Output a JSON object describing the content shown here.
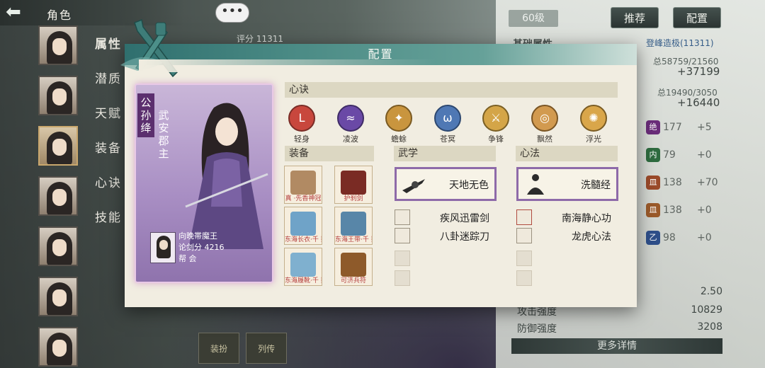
{
  "topbar": {
    "title": "角色"
  },
  "chat": {
    "label": "•••"
  },
  "level": "60级",
  "buttons": {
    "recommend": "推荐",
    "config": "配置"
  },
  "score_bg": "评分 11311",
  "basic_attr": "基础属性",
  "ascend": "登峰造极(11311)",
  "sidebar": {
    "menu": [
      "属性",
      "潜质",
      "天赋",
      "装备",
      "心诀",
      "技能"
    ]
  },
  "right_stats": {
    "total1": "总58759/21560",
    "big1": "+37199",
    "total2": "总19490/3050",
    "big2": "+16440",
    "gems": [
      {
        "glyph": "绝",
        "color": "#6a2d7a",
        "num": "177",
        "plus": "+5"
      },
      {
        "glyph": "内",
        "color": "#2e6b3f",
        "num": "79",
        "plus": "+0"
      },
      {
        "glyph": "皿",
        "color": "#9b4a2a",
        "num": "138",
        "plus": "+70"
      },
      {
        "glyph": "皿",
        "color": "#9b5a2a",
        "num": "138",
        "plus": "+0"
      },
      {
        "glyph": "乙",
        "color": "#2e4f8a",
        "num": "98",
        "plus": "+0"
      }
    ],
    "bottom": [
      {
        "label": "",
        "value": "2.50"
      },
      {
        "label": "攻击强度",
        "value": "10829"
      },
      {
        "label": "防御强度",
        "value": "3208"
      }
    ],
    "more": "更多详情"
  },
  "bottom_icons": [
    "装扮",
    "列传"
  ],
  "modal": {
    "title": "配置",
    "character": {
      "name": "公孙绛",
      "title": "武安郡主",
      "owner": "向晚帯魔王",
      "score": "论剑分 4216",
      "guild": "帮  会"
    },
    "xinjue_header": "心诀",
    "xinjue": [
      {
        "label": "轻身",
        "color": "#c8473d",
        "glyph": "L",
        "ring": "#7a2d27"
      },
      {
        "label": "凌波",
        "color": "#6a49a6",
        "glyph": "≈",
        "ring": "#3f2c66"
      },
      {
        "label": "蟾蜍",
        "color": "#c9953e",
        "glyph": "✦",
        "ring": "#7a5a22"
      },
      {
        "label": "苍冥",
        "color": "#4f78b4",
        "glyph": "ω",
        "ring": "#2d4870"
      },
      {
        "label": "争锋",
        "color": "#d4a548",
        "glyph": "⚔",
        "ring": "#7a5f24"
      },
      {
        "label": "飘然",
        "color": "#d29a4f",
        "glyph": "◎",
        "ring": "#7a5524"
      },
      {
        "label": "浮光",
        "color": "#d9a64a",
        "glyph": "✺",
        "ring": "#7a5c24"
      }
    ],
    "equip_header": "装备",
    "equipment": [
      {
        "label": "真 ·先香神冠",
        "color": "#b18a63"
      },
      {
        "label": "护刹剑",
        "color": "#7a2b24"
      },
      {
        "label": "东海长衣·千 鹅",
        "color": "#6fa3c8"
      },
      {
        "label": "东海王带·千 鹅",
        "color": "#5886a8"
      },
      {
        "label": "东海履靴·千 鹅",
        "color": "#7fb0cf"
      },
      {
        "label": "可济兵符",
        "color": "#8e5a2a"
      }
    ],
    "wuxue_header": "武学",
    "wuxue_main": "天地无色",
    "wuxue_sub": [
      "疾风迅雷剑",
      "八卦迷踪刀"
    ],
    "xinfa_header": "心法",
    "xinfa_main": "洗髓经",
    "xinfa_sub": [
      "南海静心功",
      "龙虎心法"
    ]
  }
}
